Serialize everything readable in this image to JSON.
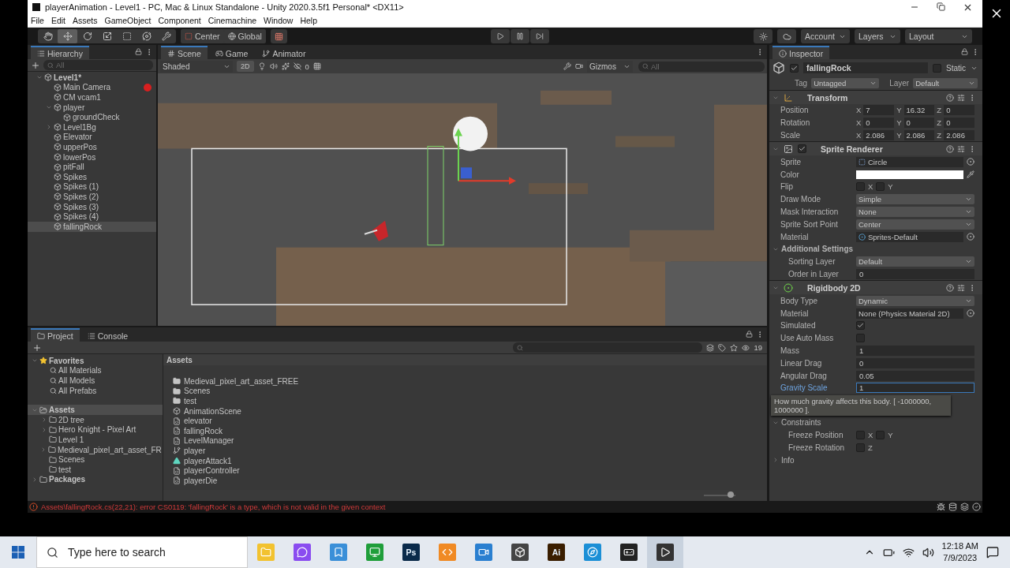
{
  "window": {
    "title": "playerAnimation - Level1 - PC, Mac & Linux Standalone - Unity 2020.3.5f1 Personal* <DX11>"
  },
  "menu": [
    "File",
    "Edit",
    "Assets",
    "GameObject",
    "Component",
    "Cinemachine",
    "Window",
    "Help"
  ],
  "toolbar": {
    "tools": [
      {
        "kind": "hand",
        "selected": false
      },
      {
        "kind": "move",
        "selected": true
      },
      {
        "kind": "rotate",
        "selected": false
      },
      {
        "kind": "scale",
        "selected": false
      },
      {
        "kind": "rect",
        "selected": false
      },
      {
        "kind": "transform",
        "selected": false
      },
      {
        "kind": "custom",
        "selected": false
      }
    ],
    "pivot": "Center",
    "space": "Global",
    "account": "Account",
    "layers": "Layers",
    "layout": "Layout"
  },
  "hierarchy": {
    "title": "Hierarchy",
    "search_placeholder": "All",
    "tree": [
      {
        "label": "Level1*",
        "expandable": true,
        "expanded": true,
        "selected": false,
        "marker": false,
        "children": [
          {
            "label": "Main Camera",
            "expandable": false,
            "expanded": false,
            "selected": false,
            "marker": true
          },
          {
            "label": "CM vcam1",
            "expandable": false,
            "expanded": false,
            "selected": false,
            "marker": false
          },
          {
            "label": "player",
            "expandable": true,
            "expanded": true,
            "selected": false,
            "marker": false,
            "children": [
              {
                "label": "groundCheck",
                "expandable": false,
                "expanded": false,
                "selected": false,
                "marker": false
              }
            ]
          },
          {
            "label": "Level1Bg",
            "expandable": true,
            "expanded": false,
            "selected": false,
            "marker": false
          },
          {
            "label": "Elevator",
            "expandable": false,
            "expanded": false,
            "selected": false,
            "marker": false
          },
          {
            "label": "upperPos",
            "expandable": false,
            "expanded": false,
            "selected": false,
            "marker": false
          },
          {
            "label": "lowerPos",
            "expandable": false,
            "expanded": false,
            "selected": false,
            "marker": false
          },
          {
            "label": "pitFall",
            "expandable": false,
            "expanded": false,
            "selected": false,
            "marker": false
          },
          {
            "label": "Spikes",
            "expandable": false,
            "expanded": false,
            "selected": false,
            "marker": false
          },
          {
            "label": "Spikes (1)",
            "expandable": false,
            "expanded": false,
            "selected": false,
            "marker": false
          },
          {
            "label": "Spikes (2)",
            "expandable": false,
            "expanded": false,
            "selected": false,
            "marker": false
          },
          {
            "label": "Spikes (3)",
            "expandable": false,
            "expanded": false,
            "selected": false,
            "marker": false
          },
          {
            "label": "Spikes (4)",
            "expandable": false,
            "expanded": false,
            "selected": false,
            "marker": false
          },
          {
            "label": "fallingRock",
            "expandable": false,
            "expanded": false,
            "selected": true,
            "marker": false
          }
        ]
      }
    ]
  },
  "scene": {
    "tabs": [
      {
        "label": "Scene",
        "kind": "scene",
        "selected": true
      },
      {
        "label": "Game",
        "kind": "game",
        "selected": false
      },
      {
        "label": "Animator",
        "kind": "animator",
        "selected": false
      }
    ],
    "shading": "Shaded",
    "mode_2d": "2D",
    "hidden_count": "0",
    "gizmos": "Gizmos",
    "search_placeholder": "All"
  },
  "inspector": {
    "title": "Inspector",
    "object": {
      "name": "fallingRock",
      "active": true,
      "static_label": "Static",
      "static": false,
      "tag_label": "Tag",
      "tag": "Untagged",
      "layer_label": "Layer",
      "layer": "Default"
    },
    "components": [
      {
        "name": "Transform",
        "kind": "transform",
        "expanded": true,
        "rows": [
          {
            "kind": "vector",
            "label": "Position",
            "fields": [
              {
                "axis": "X",
                "value": "7"
              },
              {
                "axis": "Y",
                "value": "16.32"
              },
              {
                "axis": "Z",
                "value": "0"
              }
            ]
          },
          {
            "kind": "vector",
            "label": "Rotation",
            "fields": [
              {
                "axis": "X",
                "value": "0"
              },
              {
                "axis": "Y",
                "value": "0"
              },
              {
                "axis": "Z",
                "value": "0"
              }
            ]
          },
          {
            "kind": "vector",
            "label": "Scale",
            "fields": [
              {
                "axis": "X",
                "value": "2.086"
              },
              {
                "axis": "Y",
                "value": "2.086"
              },
              {
                "axis": "Z",
                "value": "2.086"
              }
            ]
          }
        ]
      },
      {
        "name": "Sprite Renderer",
        "kind": "sprite",
        "expanded": true,
        "enabled": true,
        "rows": [
          {
            "kind": "sprite_object",
            "label": "Sprite",
            "value": "Circle"
          },
          {
            "kind": "color",
            "label": "Color",
            "color": "#ffffff"
          },
          {
            "kind": "toggles",
            "label": "Flip",
            "toggles": [
              {
                "axis": "X",
                "checked": false
              },
              {
                "axis": "Y",
                "checked": false
              }
            ]
          },
          {
            "kind": "dropdown",
            "label": "Draw Mode",
            "value": "Simple"
          },
          {
            "kind": "dropdown",
            "label": "Mask Interaction",
            "value": "None"
          },
          {
            "kind": "dropdown",
            "label": "Sprite Sort Point",
            "value": "Center"
          },
          {
            "kind": "material_object",
            "label": "Material",
            "value": "Sprites-Default"
          },
          {
            "kind": "group",
            "label": "Additional Settings",
            "expanded": true,
            "rows": [
              {
                "kind": "dropdown",
                "label": "Sorting Layer",
                "value": "Default"
              },
              {
                "kind": "field",
                "label": "Order in Layer",
                "value": "0",
                "focused": false
              }
            ]
          }
        ]
      },
      {
        "name": "Rigidbody 2D",
        "kind": "rigidbody",
        "expanded": true,
        "rows": [
          {
            "kind": "dropdown",
            "label": "Body Type",
            "value": "Dynamic"
          },
          {
            "kind": "object",
            "label": "Material",
            "value": "None (Physics Material 2D)"
          },
          {
            "kind": "checkbox",
            "label": "Simulated",
            "checked": true
          },
          {
            "kind": "checkbox",
            "label": "Use Auto Mass",
            "checked": false
          },
          {
            "kind": "field",
            "label": "Mass",
            "value": "1",
            "focused": false
          },
          {
            "kind": "field",
            "label": "Linear Drag",
            "value": "0",
            "focused": false
          },
          {
            "kind": "field",
            "label": "Angular Drag",
            "value": "0.05",
            "focused": false
          },
          {
            "kind": "field",
            "label": "Gravity Scale",
            "value": "1",
            "focused": true
          },
          {
            "kind": "tooltip",
            "text": "How much gravity affects this body. [ -1000000, 1000000 ]."
          },
          {
            "kind": "group",
            "label": "Constraints",
            "expanded": true,
            "rows": [
              {
                "kind": "toggles",
                "label": "Freeze Position",
                "toggles": [
                  {
                    "axis": "X",
                    "checked": false
                  },
                  {
                    "axis": "Y",
                    "checked": false
                  }
                ]
              },
              {
                "kind": "toggles",
                "label": "Freeze Rotation",
                "toggles": [
                  {
                    "axis": "Z",
                    "checked": false
                  }
                ]
              }
            ]
          },
          {
            "kind": "group",
            "label": "Info",
            "expanded": false,
            "rows": []
          }
        ]
      }
    ]
  },
  "project": {
    "tabs": [
      {
        "label": "Project",
        "kind": "project",
        "selected": true
      },
      {
        "label": "Console",
        "kind": "console",
        "selected": false
      }
    ],
    "hidden_count": "19",
    "favorites": {
      "label": "Favorites",
      "expanded": true,
      "items": [
        "All Materials",
        "All Models",
        "All Prefabs"
      ]
    },
    "tree": [
      {
        "label": "Assets",
        "expandable": true,
        "expanded": true,
        "selected": true,
        "children": [
          {
            "label": "2D tree",
            "expandable": true,
            "expanded": false,
            "selected": false
          },
          {
            "label": "Hero Knight - Pixel Art",
            "expandable": true,
            "expanded": false,
            "selected": false
          },
          {
            "label": "Level 1",
            "expandable": false,
            "expanded": false,
            "selected": false
          },
          {
            "label": "Medieval_pixel_art_asset_FR",
            "expandable": true,
            "expanded": false,
            "selected": false
          },
          {
            "label": "Scenes",
            "expandable": false,
            "expanded": false,
            "selected": false
          },
          {
            "label": "test",
            "expandable": false,
            "expanded": false,
            "selected": false
          }
        ]
      },
      {
        "label": "Packages",
        "expandable": true,
        "expanded": false,
        "selected": false
      }
    ],
    "breadcrumb": "Assets",
    "files": [
      {
        "name": "Medieval_pixel_art_asset_FREE",
        "kind": "folder"
      },
      {
        "name": "Scenes",
        "kind": "folder"
      },
      {
        "name": "test",
        "kind": "folder"
      },
      {
        "name": "AnimationScene",
        "kind": "scene"
      },
      {
        "name": "elevator",
        "kind": "script"
      },
      {
        "name": "fallingRock",
        "kind": "script"
      },
      {
        "name": "LevelManager",
        "kind": "script"
      },
      {
        "name": "player",
        "kind": "animator"
      },
      {
        "name": "playerAttack1",
        "kind": "clip"
      },
      {
        "name": "playerController",
        "kind": "script"
      },
      {
        "name": "playerDie",
        "kind": "script"
      }
    ],
    "icon_size": {
      "level": 0.85
    }
  },
  "status": {
    "kind": "error",
    "message": "Assets\\fallingRock.cs(22,21): error CS0119: 'fallingRock' is a type, which is not valid in the given context"
  },
  "taskbar": {
    "search_placeholder": "Type here to search",
    "apps": [
      {
        "kind": "files",
        "color": "#f2c230"
      },
      {
        "kind": "messenger",
        "color": "#8a4cf0"
      },
      {
        "kind": "app",
        "color": "#3a8fd8"
      },
      {
        "kind": "sheet",
        "color": "#1f9e3a"
      },
      {
        "kind": "tile",
        "label": "Ps",
        "color": "#0a2a4a"
      },
      {
        "kind": "code",
        "color": "#f08a24"
      },
      {
        "kind": "video",
        "color": "#2a7fd0"
      },
      {
        "kind": "cube",
        "color": "#444444"
      },
      {
        "kind": "tile",
        "label": "Ai",
        "color": "#3a1e00"
      },
      {
        "kind": "browser",
        "color": "#1b8fd6"
      },
      {
        "kind": "unity",
        "color": "#222222"
      },
      {
        "kind": "player",
        "color": "#333333"
      }
    ],
    "time": "12:18 AM",
    "date": "7/9/2023"
  }
}
